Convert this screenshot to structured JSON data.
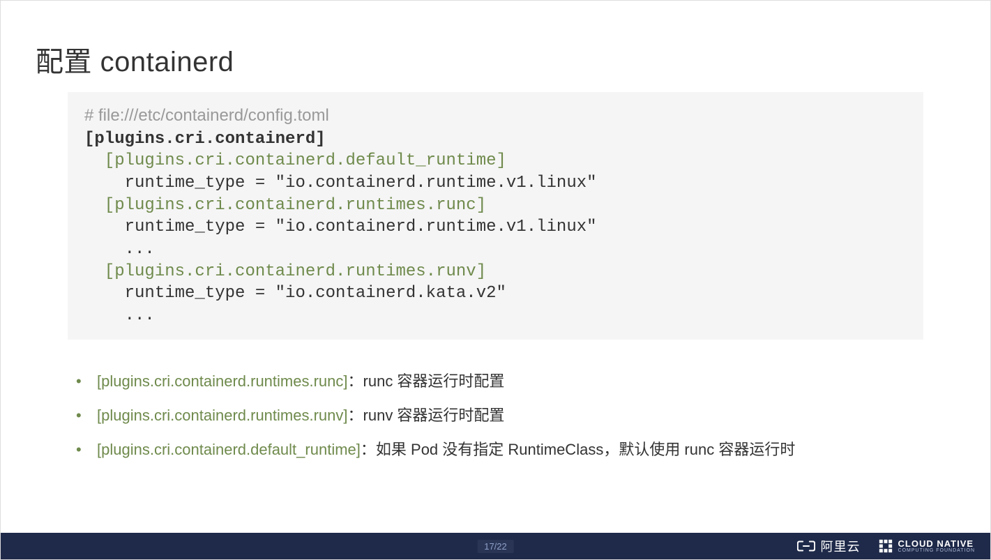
{
  "title": "配置 containerd",
  "code": {
    "comment": "# file:///etc/containerd/config.toml",
    "line1": "[plugins.cri.containerd]",
    "line2": "  [plugins.cri.containerd.default_runtime]",
    "line3": "    runtime_type = \"io.containerd.runtime.v1.linux\"",
    "line4": "  [plugins.cri.containerd.runtimes.runc]",
    "line5": "    runtime_type = \"io.containerd.runtime.v1.linux\"",
    "line6": "    ...",
    "line7": "  [plugins.cri.containerd.runtimes.runv]",
    "line8": "    runtime_type = \"io.containerd.kata.v2\"",
    "line9": "    ..."
  },
  "bullets": [
    {
      "key": "[plugins.cri.containerd.runtimes.runc]",
      "sep": "：",
      "desc": "runc 容器运行时配置"
    },
    {
      "key": "[plugins.cri.containerd.runtimes.runv]",
      "sep": "：",
      "desc": "runv 容器运行时配置"
    },
    {
      "key": "[plugins.cri.containerd.default_runtime]",
      "sep": "：",
      "desc": "如果 Pod 没有指定 RuntimeClass，默认使用 runc 容器运行时"
    }
  ],
  "footer": {
    "page": "17/22",
    "aliyun": "阿里云",
    "cncf_main": "CLOUD NATIVE",
    "cncf_sub": "COMPUTING FOUNDATION"
  }
}
